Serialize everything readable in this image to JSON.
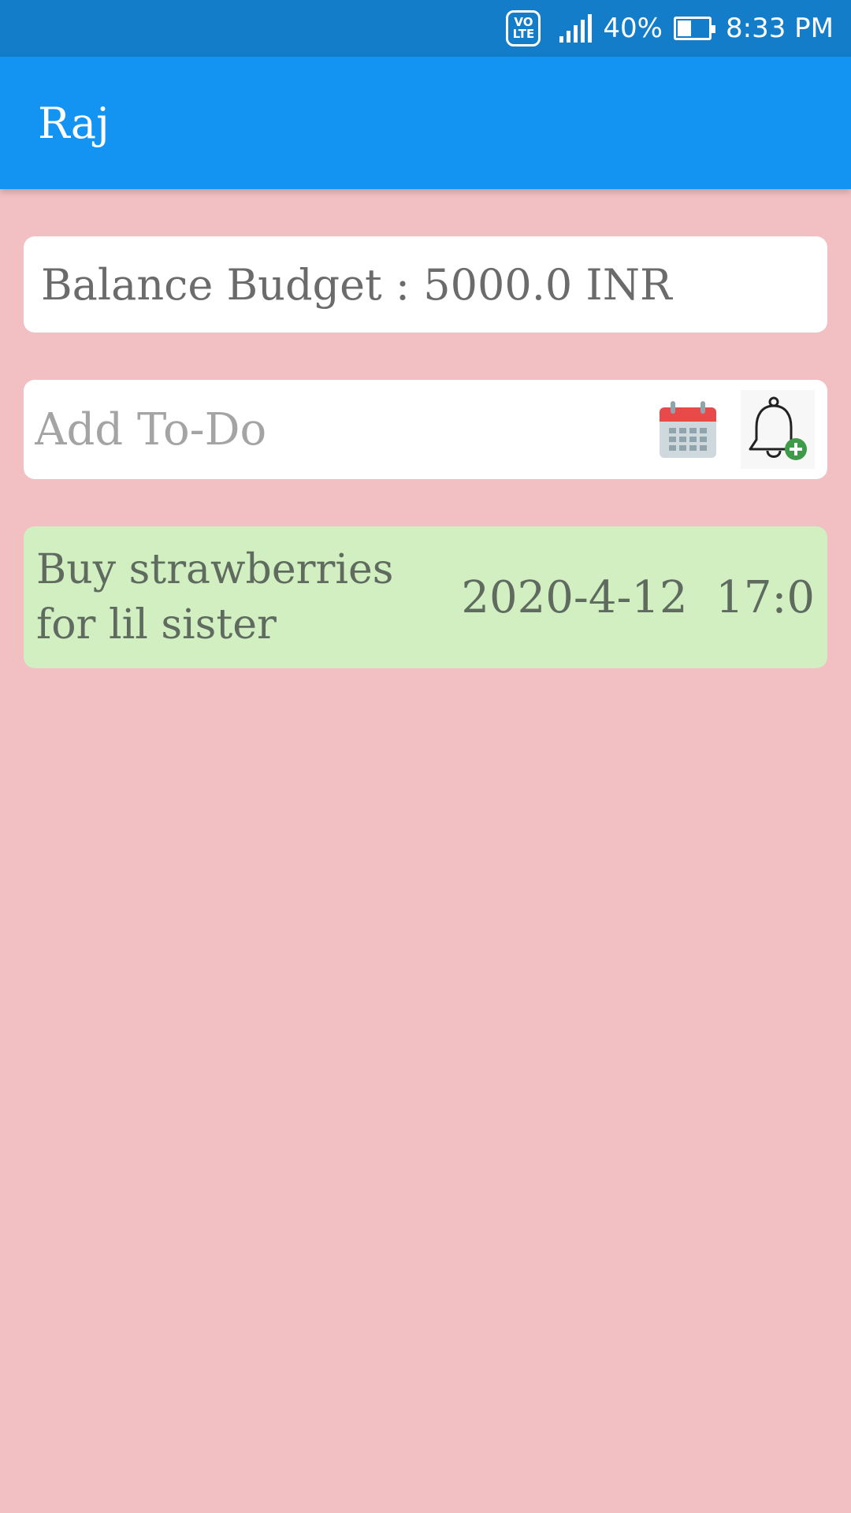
{
  "status_bar": {
    "network_badge_top": "VO",
    "network_badge_bottom": "LTE",
    "battery_percent": "40%",
    "battery_level": 0.4,
    "time": "8:33 PM"
  },
  "app_bar": {
    "title": "Raj"
  },
  "budget": {
    "text": "Balance Budget : 5000.0 INR"
  },
  "add_todo": {
    "placeholder": "Add To-Do",
    "value": "",
    "icons": [
      "calendar-icon",
      "bell-add-icon"
    ]
  },
  "tasks": [
    {
      "title": "Buy strawberries for lil sister",
      "datetime": "2020-4-12  17:0"
    }
  ],
  "colors": {
    "status_bar": "#137dca",
    "app_bar": "#1394f3",
    "background": "#f2c0c2",
    "task_background": "#d1efc1",
    "calendar_red": "#e84a4a",
    "bell_plus_green": "#3f9b49"
  }
}
